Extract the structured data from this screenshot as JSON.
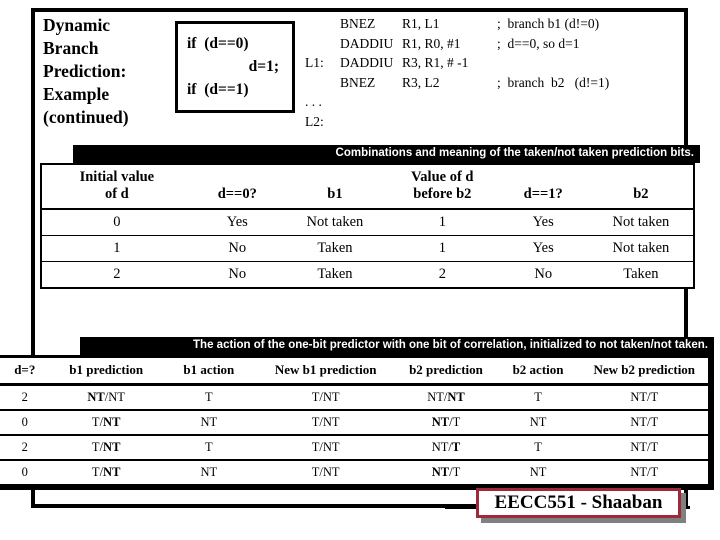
{
  "slide": {
    "title_lines": [
      "Dynamic",
      "Branch",
      "Prediction:",
      "Example",
      "(continued)"
    ]
  },
  "code_box": {
    "lines": [
      "if  (d==0)",
      "d=1;",
      "if  (d==1)"
    ]
  },
  "assembly": {
    "rows": [
      {
        "label": "",
        "op": "BNEZ",
        "args": "R1, L1",
        "comment": ";  branch b1 (d!=0)"
      },
      {
        "label": "",
        "op": "DADDIU",
        "args": "R1, R0, #1",
        "comment": ";  d==0, so d=1"
      },
      {
        "label": "L1:",
        "op": "DADDIU",
        "args": "R3, R1, # -1",
        "comment": ""
      },
      {
        "label": "",
        "op": "BNEZ",
        "args": "R3, L2",
        "comment": ";  branch  b2   (d!=1)"
      },
      {
        "label": ". . .",
        "op": "",
        "args": "",
        "comment": ""
      },
      {
        "label": "L2:",
        "op": "",
        "args": "",
        "comment": ""
      }
    ]
  },
  "table1": {
    "caption": "Combinations and meaning of the taken/not taken prediction bits.",
    "headers": [
      "Initial value\nof d",
      "d==0?",
      "b1",
      "Value of d\nbefore b2",
      "d==1?",
      "b2"
    ],
    "header_lines": [
      [
        "Initial value",
        "of d"
      ],
      [
        "",
        "d==0?"
      ],
      [
        "",
        "b1"
      ],
      [
        "Value of d",
        "before b2"
      ],
      [
        "",
        "d==1?"
      ],
      [
        "",
        "b2"
      ]
    ],
    "rows": [
      [
        "0",
        "Yes",
        "Not taken",
        "1",
        "Yes",
        "Not taken"
      ],
      [
        "1",
        "No",
        "Taken",
        "1",
        "Yes",
        "Not taken"
      ],
      [
        "2",
        "No",
        "Taken",
        "2",
        "No",
        "Taken"
      ]
    ]
  },
  "table2": {
    "caption": "The action of the one-bit predictor with one bit of correlation, initialized to not taken/not taken.",
    "headers": [
      "d=?",
      "b1 prediction",
      "b1 action",
      "New b1 prediction",
      "b2 prediction",
      "b2 action",
      "New b2 prediction"
    ],
    "rows": [
      {
        "d": "2",
        "b1_prediction": {
          "first": "NT",
          "first_bold": true,
          "second": "NT",
          "second_bold": false
        },
        "b1_action": "T",
        "new_b1_prediction": "T/NT",
        "b2_prediction": {
          "first": "NT",
          "first_bold": false,
          "second": "NT",
          "second_bold": true
        },
        "b2_action": "T",
        "new_b2_prediction": "NT/T"
      },
      {
        "d": "0",
        "b1_prediction": {
          "first": "T",
          "first_bold": false,
          "second": "NT",
          "second_bold": true
        },
        "b1_action": "NT",
        "new_b1_prediction": "T/NT",
        "b2_prediction": {
          "first": "NT",
          "first_bold": true,
          "second": "T",
          "second_bold": false
        },
        "b2_action": "NT",
        "new_b2_prediction": "NT/T"
      },
      {
        "d": "2",
        "b1_prediction": {
          "first": "T",
          "first_bold": false,
          "second": "NT",
          "second_bold": true
        },
        "b1_action": "T",
        "new_b1_prediction": "T/NT",
        "b2_prediction": {
          "first": "NT",
          "first_bold": false,
          "second": "T",
          "second_bold": true
        },
        "b2_action": "T",
        "new_b2_prediction": "NT/T"
      },
      {
        "d": "0",
        "b1_prediction": {
          "first": "T",
          "first_bold": false,
          "second": "NT",
          "second_bold": true
        },
        "b1_action": "NT",
        "new_b1_prediction": "T/NT",
        "b2_prediction": {
          "first": "NT",
          "first_bold": true,
          "second": "T",
          "second_bold": false
        },
        "b2_action": "NT",
        "new_b2_prediction": "NT/T"
      }
    ]
  },
  "footer": {
    "badge_label": "EECC551 - Shaaban",
    "badge_border_color": "#9c2a3a"
  }
}
